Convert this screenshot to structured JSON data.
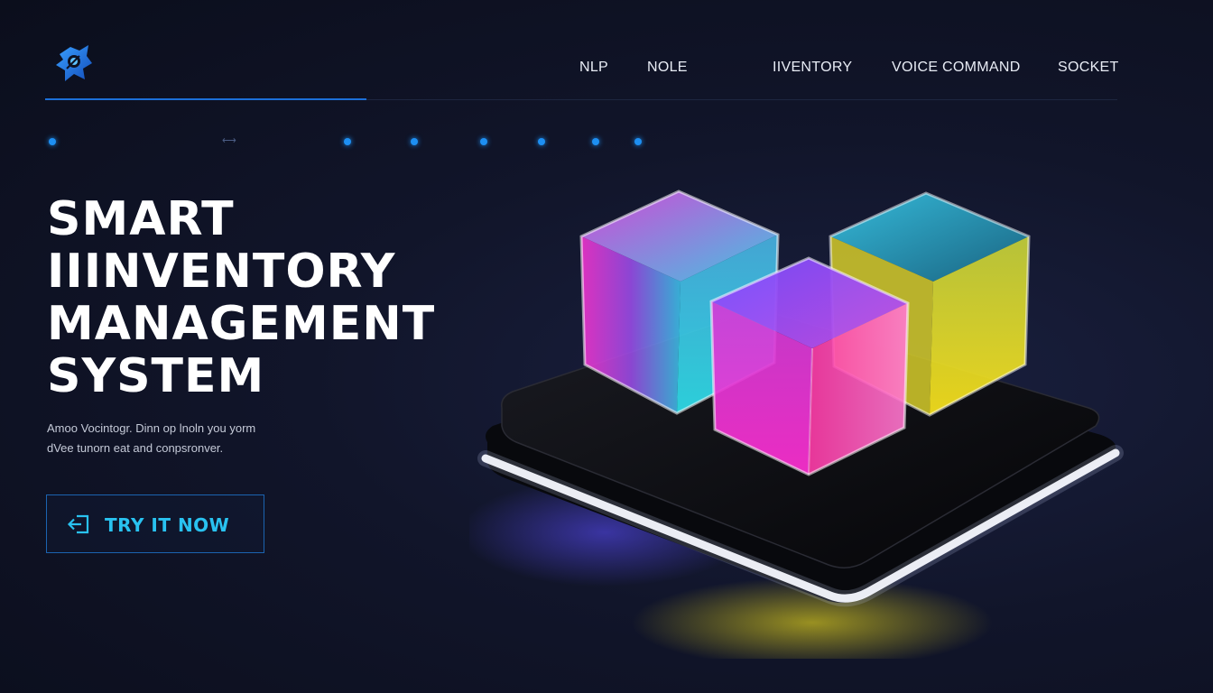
{
  "header": {
    "logo_icon": "robot-tech-logo-icon",
    "nav": [
      {
        "label": "NLP"
      },
      {
        "label": "NOLE"
      },
      {
        "label": "IIVENTORY"
      },
      {
        "label": "VOICE COMMAND"
      },
      {
        "label": "SOCKET"
      }
    ]
  },
  "progress": {
    "dot_count": 7,
    "arrow_glyph": "⟷"
  },
  "hero": {
    "title_lines": [
      "SMART",
      "IIINVENTORY",
      "MANAGEMENT",
      "SYSTEM"
    ],
    "subtitle_lines": [
      "Amoo Vocintogr. Dinn op lnoln you yorm",
      "dVee tunorn eat and conpsronver."
    ],
    "cta_label": "TRY IT NOW",
    "cta_icon": "login-arrow-icon"
  },
  "illustration": {
    "icon": "glowing-cubes-on-platform-illustration",
    "colors": {
      "cyan": "#2fd6ee",
      "magenta": "#ff2fd2",
      "yellow": "#f4e21c",
      "purple": "#8b4bff",
      "platform": "#0b0c10",
      "glow": "#ffffff"
    }
  },
  "theme": {
    "background": "#0d1121",
    "accent": "#1d8ff2",
    "cta_text": "#29c2f0"
  }
}
